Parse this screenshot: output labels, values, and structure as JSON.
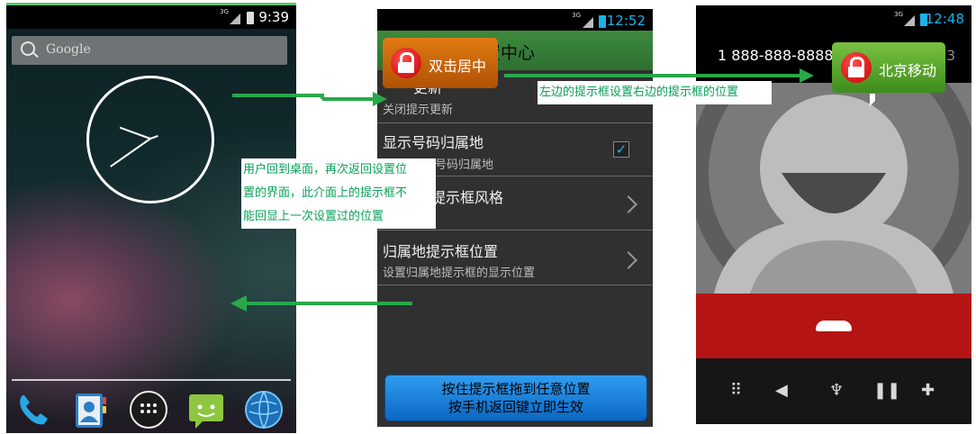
{
  "phone1": {
    "status_time": "9:39",
    "network": "3G",
    "search_placeholder": "Google",
    "dock": [
      "phone-icon",
      "contacts-icon",
      "apps-icon",
      "messaging-icon",
      "browser-icon"
    ]
  },
  "phone2": {
    "status_time": "12:52",
    "network": "3G",
    "header_title": "设置中心",
    "header_title_partial": "置中心",
    "toast_label": "双击居中",
    "rows": [
      {
        "title": "更新",
        "subtitle": "关闭提示更新"
      },
      {
        "title": "显示号码归属地",
        "subtitle": "号码归属地",
        "checked": true
      },
      {
        "title": "提示框风格",
        "subtitle": ""
      },
      {
        "title": "归属地提示框位置",
        "subtitle": "设置归属地提示框的显示位置"
      }
    ],
    "button_line1": "按住提示框拖到任意位置",
    "button_line2": "按手机返回键立即生效"
  },
  "phone3": {
    "status_time": "12:48",
    "network": "3G",
    "caller_number": "1 888-888-8888",
    "caller_tail": "3",
    "toast_label": "北京移动",
    "controls": [
      "dialpad-icon",
      "speaker-icon",
      "mute-icon",
      "hold-icon",
      "add-call-icon"
    ]
  },
  "annotations": {
    "note_top": "左边的提示框设置右边的提示框的位置",
    "note_middle_lines": [
      "用户回到桌面，再次返回设置位",
      "置的界面，此介面上的提示框不",
      "能回显上一次设置过的位置"
    ]
  },
  "colors": {
    "arrow": "#29a84a",
    "accent_blue": "#1ab2e8",
    "end_call_red": "#b51414",
    "header_green": "#2f6f31"
  }
}
